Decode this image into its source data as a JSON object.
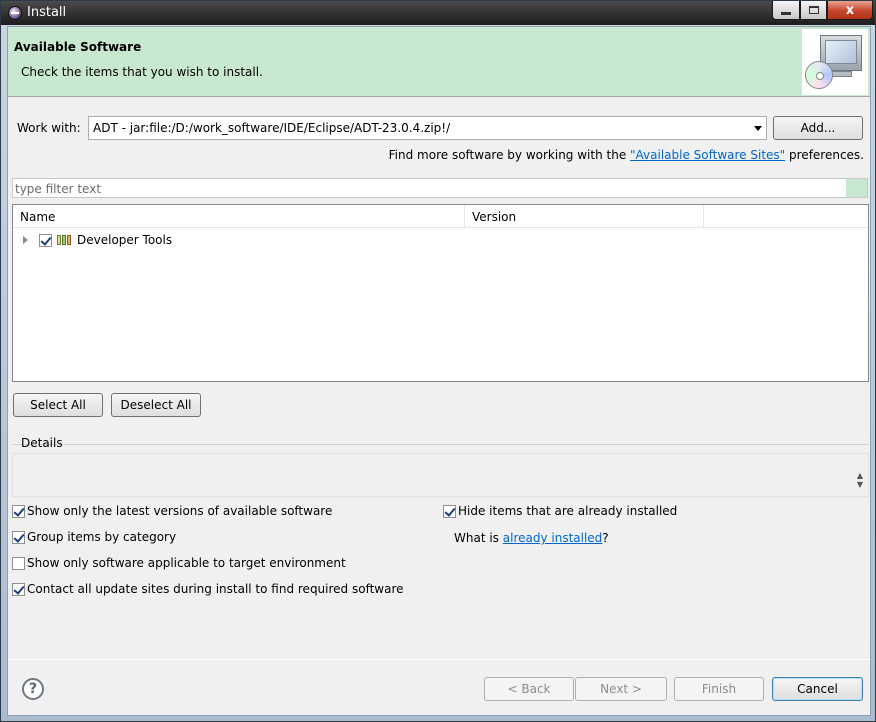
{
  "window": {
    "title": "Install",
    "controls": {
      "minimize": "minimize-icon",
      "maximize": "maximize-icon",
      "close": "x"
    }
  },
  "header": {
    "title": "Available Software",
    "description": "Check the items that you wish to install."
  },
  "work_with": {
    "label": "Work with:",
    "value": "ADT - jar:file:/D:/work_software/IDE/Eclipse/ADT-23.0.4.zip!/",
    "add_button": "Add..."
  },
  "find_more": {
    "prefix": "Find more software by working with the ",
    "link": "\"Available Software Sites\"",
    "suffix": " preferences."
  },
  "filter": {
    "placeholder": "type filter text"
  },
  "tree": {
    "columns": [
      "Name",
      "Version"
    ],
    "items": [
      {
        "label": "Developer Tools",
        "checked": true,
        "expanded": false
      }
    ]
  },
  "selection_buttons": {
    "select_all": "Select All",
    "deselect_all": "Deselect All"
  },
  "details": {
    "label": "Details"
  },
  "options": {
    "latest_versions": {
      "label": "Show only the latest versions of available software",
      "checked": true
    },
    "group_by_category": {
      "label": "Group items by category",
      "checked": true
    },
    "target_env": {
      "label": "Show only software applicable to target environment",
      "checked": false
    },
    "contact_sites": {
      "label": "Contact all update sites during install to find required software",
      "checked": true
    },
    "hide_installed": {
      "label": "Hide items that are already installed",
      "checked": true
    }
  },
  "whatis": {
    "prefix": "What is ",
    "link": "already installed",
    "suffix": "?"
  },
  "footer": {
    "help": "?",
    "back": "< Back",
    "next": "Next >",
    "finish": "Finish",
    "cancel": "Cancel"
  }
}
